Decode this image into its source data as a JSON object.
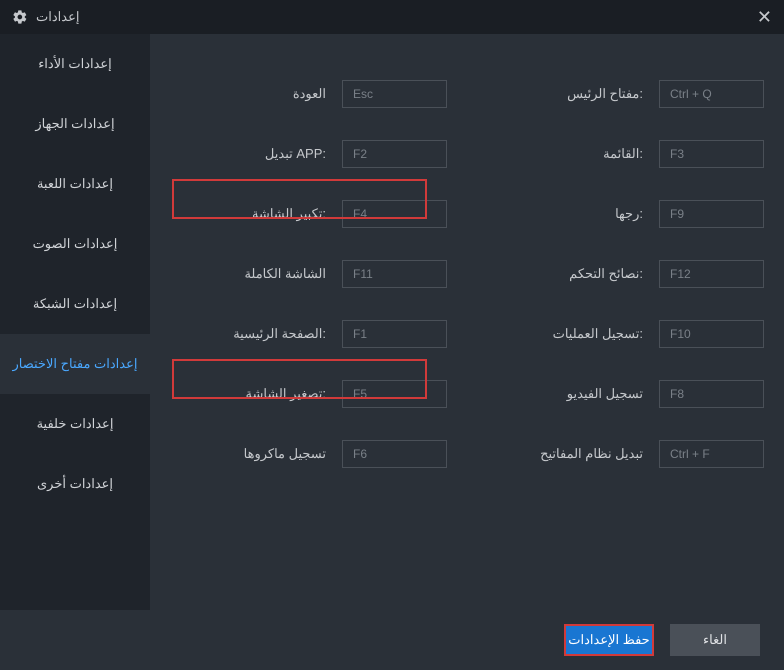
{
  "window": {
    "title": "إعدادات"
  },
  "sidebar": {
    "items": [
      {
        "label": "إعدادات الأداء"
      },
      {
        "label": "إعدادات الجهاز"
      },
      {
        "label": "إعدادات اللعبة"
      },
      {
        "label": "إعدادات الصوت"
      },
      {
        "label": "إعدادات الشبكة"
      },
      {
        "label": "إعدادات مفتاح الاختصار"
      },
      {
        "label": "إعدادات خلفية"
      },
      {
        "label": "إعدادات أخرى"
      }
    ],
    "active_index": 5
  },
  "shortcuts": {
    "left": [
      {
        "label": "العودة",
        "value": "Esc"
      },
      {
        "label": "تبديل APP:",
        "value": "F2"
      },
      {
        "label": "تكبير الشاشة:",
        "value": "F4"
      },
      {
        "label": "الشاشة الكاملة",
        "value": "F11"
      },
      {
        "label": "الصفحة الرئيسية:",
        "value": "F1"
      },
      {
        "label": "تصغير الشاشة:",
        "value": "F5"
      },
      {
        "label": "تسجيل ماكروها",
        "value": "F6"
      }
    ],
    "right": [
      {
        "label": "مفتاح الرئيس:",
        "value": "Ctrl + Q"
      },
      {
        "label": "القائمة:",
        "value": "F3"
      },
      {
        "label": "رجها:",
        "value": "F9"
      },
      {
        "label": "نصائح التحكم:",
        "value": "F12"
      },
      {
        "label": "تسجيل العمليات:",
        "value": "F10"
      },
      {
        "label": "تسجيل الفيديو",
        "value": "F8"
      },
      {
        "label": "تبديل نظام المفاتيح",
        "value": "Ctrl + F"
      }
    ]
  },
  "footer": {
    "save_label": "حفظ الإعدادات",
    "cancel_label": "الغاء"
  }
}
